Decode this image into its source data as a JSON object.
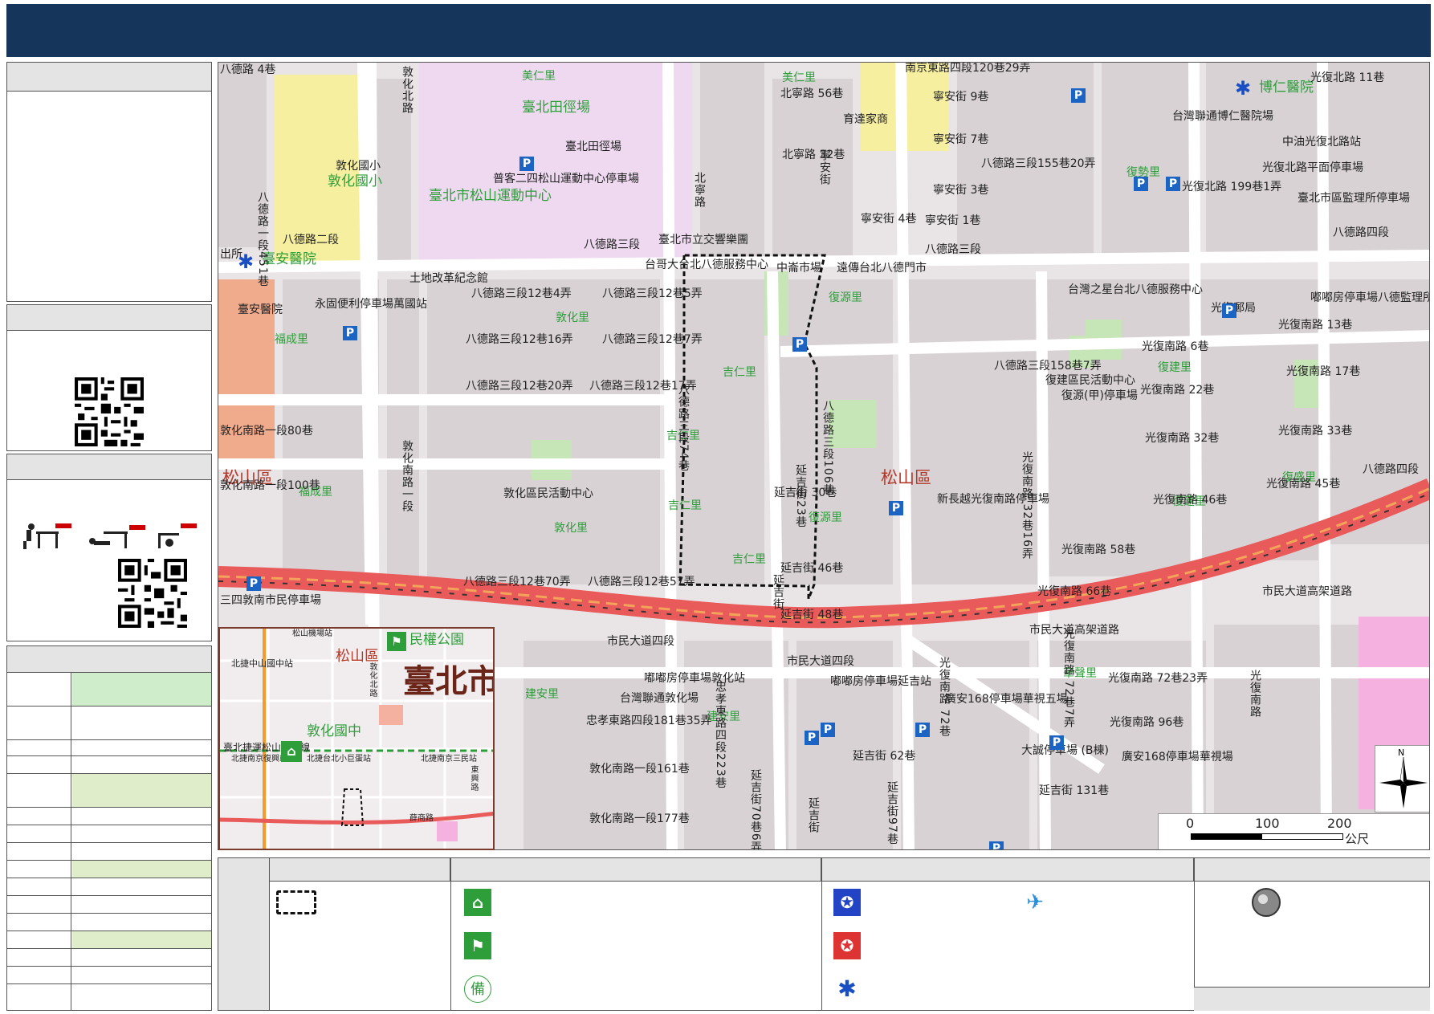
{
  "map": {
    "district_labels": [
      "松山區",
      "松山區"
    ],
    "green_labels": [
      "美仁里",
      "臺北田徑場",
      "敦化國小",
      "臺北市松山運動中心",
      "美仁里",
      "臺安醫院",
      "福成里",
      "敦化里",
      "吉仁里",
      "吉仁里",
      "吉仁里",
      "吉仁里",
      "福成里",
      "敦化里",
      "建安里",
      "建安里",
      "復源里",
      "復勢里",
      "復建里",
      "復建里",
      "復源里",
      "復盛里",
      "華聲里",
      "博仁醫院"
    ],
    "dark_labels": [
      "八德路二段",
      "八德路三段",
      "臺北市立交響樂團",
      "台哥大台北八德服務中心",
      "中崙市場",
      "遠傳台北八德門市",
      "八德路三段",
      "土地改革紀念館",
      "永固便利停車場萬國站",
      "八德路三段12巷4弄",
      "八德路三段12巷5弄",
      "八德路三段12巷16弄",
      "八德路三段12巷7弄",
      "八德路三段12巷20弄",
      "八德路三段12巷17弄",
      "敦化南路一段80巷",
      "敦化南路一段100巷",
      "敦化區民活動中心",
      "八德路三段12巷70弄",
      "八德路三段12巷57弄",
      "三四敦南市民停車場",
      "市民大道四段",
      "嘟嘟房停車場敦化站",
      "台灣聯通敦化場",
      "忠孝東路四段181巷35弄",
      "敦化南路一段161巷",
      "敦化南路一段177巷",
      "延吉街 30巷",
      "延吉街 46巷",
      "延吉街 48巷",
      "市民大道四段",
      "嘟嘟房停車場延吉站",
      "八德路三段158巷7弄",
      "復建區民活動中心",
      "復源(甲)停車場",
      "新長越光復南路停車場",
      "光復南路 6巷",
      "光復南路 22巷",
      "光復南路 32巷",
      "光復南路 46巷",
      "光復南路 13巷",
      "光復南路 17巷",
      "光復南路 45巷",
      "光復南路 58巷",
      "光復南路 66巷",
      "光復南路 72巷23弄",
      "光復南路 96巷",
      "市民大道高架道路",
      "市民大道高架道路",
      "廣安168停車場華視五場",
      "大誠停車場 (B棟)",
      "廣安168停車場華視場",
      "延吉街 131巷",
      "延吉街 62巷",
      "普客二四松山運動中心停車場",
      "臺北田徑場",
      "敦化國小",
      "北寧路 56巷",
      "北寧路 32巷",
      "育達家商",
      "寧安街 9巷",
      "寧安街 7巷",
      "八德路三段155巷20弄",
      "寧安街 3巷",
      "寧安街 4巷",
      "寧安街 1巷",
      "光復北路 11巷",
      "台灣聯通博仁醫院場",
      "中油光復北路站",
      "光復北路平面停車場",
      "臺北市區監理所停車場",
      "光復北路 199巷1弄",
      "八德路四段",
      "台灣之星台北八德服務中心",
      "光復郵局",
      "嘟嘟房停車場八德監理所",
      "臺安醫院",
      "八德路四段",
      "南京東路四段120巷29弄",
      "八德路 4巷",
      "出所",
      "光復南路 33巷"
    ],
    "vertical_labels": [
      "敦化北路",
      "北寧路",
      "八德路一段451巷",
      "敦化南路一段",
      "八德路三段74巷",
      "延吉街23巷",
      "八德路三段106巷",
      "忠孝東路四段223巷",
      "延吉街70巷6弄",
      "延吉街",
      "延吉街97巷",
      "光復南路 32巷16弄",
      "光復南路 72巷7弄",
      "光復南路",
      "光復南路 72巷",
      "延吉街",
      "寧安街"
    ],
    "scale": {
      "ticks": [
        "0",
        "100",
        "200"
      ],
      "unit": "公尺"
    },
    "north": "N"
  },
  "inset": {
    "labels": [
      "松山機場站",
      "北捷中山國中站",
      "松山區",
      "民權公園",
      "臺北市",
      "敦化國中",
      "臺北捷運松山新店線",
      "北捷南京復興站",
      "北捷台北小巨蛋站",
      "北捷南京三民站",
      "敦化北路",
      "東興路",
      "薛商路"
    ]
  },
  "colors": {
    "banner": "#16355a",
    "road": "#e95a5a",
    "green": "#2e9e3a",
    "parking": "#1c64c4",
    "table_green": "#cfeccb"
  }
}
